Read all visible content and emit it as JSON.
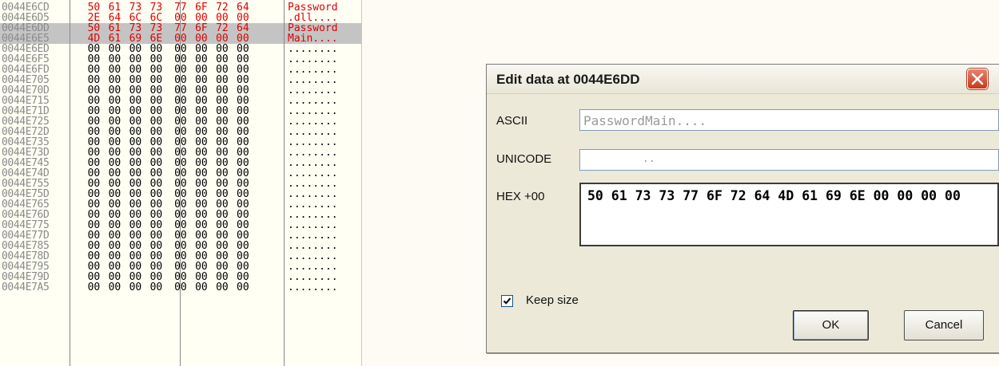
{
  "dump": {
    "rows": [
      {
        "addr": "0044E6CD",
        "bytes": [
          "50",
          "61",
          "73",
          "73",
          "77",
          "6F",
          "72",
          "64"
        ],
        "ascii": "Password",
        "style": "red"
      },
      {
        "addr": "0044E6D5",
        "bytes": [
          "2E",
          "64",
          "6C",
          "6C",
          "00",
          "00",
          "00",
          "00"
        ],
        "ascii": ".dll....",
        "style": "red"
      },
      {
        "addr": "0044E6DD",
        "bytes": [
          "50",
          "61",
          "73",
          "73",
          "77",
          "6F",
          "72",
          "64"
        ],
        "ascii": "Password",
        "style": "red-selected"
      },
      {
        "addr": "0044E6E5",
        "bytes": [
          "4D",
          "61",
          "69",
          "6E",
          "00",
          "00",
          "00",
          "00"
        ],
        "ascii": "Main....",
        "style": "red-selected"
      },
      {
        "addr": "0044E6ED",
        "bytes": [
          "00",
          "00",
          "00",
          "00",
          "00",
          "00",
          "00",
          "00"
        ],
        "ascii": "........",
        "style": "normal"
      },
      {
        "addr": "0044E6F5",
        "bytes": [
          "00",
          "00",
          "00",
          "00",
          "00",
          "00",
          "00",
          "00"
        ],
        "ascii": "........",
        "style": "normal"
      },
      {
        "addr": "0044E6FD",
        "bytes": [
          "00",
          "00",
          "00",
          "00",
          "00",
          "00",
          "00",
          "00"
        ],
        "ascii": "........",
        "style": "normal"
      },
      {
        "addr": "0044E705",
        "bytes": [
          "00",
          "00",
          "00",
          "00",
          "00",
          "00",
          "00",
          "00"
        ],
        "ascii": "........",
        "style": "normal"
      },
      {
        "addr": "0044E70D",
        "bytes": [
          "00",
          "00",
          "00",
          "00",
          "00",
          "00",
          "00",
          "00"
        ],
        "ascii": "........",
        "style": "normal"
      },
      {
        "addr": "0044E715",
        "bytes": [
          "00",
          "00",
          "00",
          "00",
          "00",
          "00",
          "00",
          "00"
        ],
        "ascii": "........",
        "style": "normal"
      },
      {
        "addr": "0044E71D",
        "bytes": [
          "00",
          "00",
          "00",
          "00",
          "00",
          "00",
          "00",
          "00"
        ],
        "ascii": "........",
        "style": "normal"
      },
      {
        "addr": "0044E725",
        "bytes": [
          "00",
          "00",
          "00",
          "00",
          "00",
          "00",
          "00",
          "00"
        ],
        "ascii": "........",
        "style": "normal"
      },
      {
        "addr": "0044E72D",
        "bytes": [
          "00",
          "00",
          "00",
          "00",
          "00",
          "00",
          "00",
          "00"
        ],
        "ascii": "........",
        "style": "normal"
      },
      {
        "addr": "0044E735",
        "bytes": [
          "00",
          "00",
          "00",
          "00",
          "00",
          "00",
          "00",
          "00"
        ],
        "ascii": "........",
        "style": "normal"
      },
      {
        "addr": "0044E73D",
        "bytes": [
          "00",
          "00",
          "00",
          "00",
          "00",
          "00",
          "00",
          "00"
        ],
        "ascii": "........",
        "style": "normal"
      },
      {
        "addr": "0044E745",
        "bytes": [
          "00",
          "00",
          "00",
          "00",
          "00",
          "00",
          "00",
          "00"
        ],
        "ascii": "........",
        "style": "normal"
      },
      {
        "addr": "0044E74D",
        "bytes": [
          "00",
          "00",
          "00",
          "00",
          "00",
          "00",
          "00",
          "00"
        ],
        "ascii": "........",
        "style": "normal"
      },
      {
        "addr": "0044E755",
        "bytes": [
          "00",
          "00",
          "00",
          "00",
          "00",
          "00",
          "00",
          "00"
        ],
        "ascii": "........",
        "style": "normal"
      },
      {
        "addr": "0044E75D",
        "bytes": [
          "00",
          "00",
          "00",
          "00",
          "00",
          "00",
          "00",
          "00"
        ],
        "ascii": "........",
        "style": "normal"
      },
      {
        "addr": "0044E765",
        "bytes": [
          "00",
          "00",
          "00",
          "00",
          "00",
          "00",
          "00",
          "00"
        ],
        "ascii": "........",
        "style": "normal"
      },
      {
        "addr": "0044E76D",
        "bytes": [
          "00",
          "00",
          "00",
          "00",
          "00",
          "00",
          "00",
          "00"
        ],
        "ascii": "........",
        "style": "normal"
      },
      {
        "addr": "0044E775",
        "bytes": [
          "00",
          "00",
          "00",
          "00",
          "00",
          "00",
          "00",
          "00"
        ],
        "ascii": "........",
        "style": "normal"
      },
      {
        "addr": "0044E77D",
        "bytes": [
          "00",
          "00",
          "00",
          "00",
          "00",
          "00",
          "00",
          "00"
        ],
        "ascii": "........",
        "style": "normal"
      },
      {
        "addr": "0044E785",
        "bytes": [
          "00",
          "00",
          "00",
          "00",
          "00",
          "00",
          "00",
          "00"
        ],
        "ascii": "........",
        "style": "normal"
      },
      {
        "addr": "0044E78D",
        "bytes": [
          "00",
          "00",
          "00",
          "00",
          "00",
          "00",
          "00",
          "00"
        ],
        "ascii": "........",
        "style": "normal"
      },
      {
        "addr": "0044E795",
        "bytes": [
          "00",
          "00",
          "00",
          "00",
          "00",
          "00",
          "00",
          "00"
        ],
        "ascii": "........",
        "style": "normal"
      },
      {
        "addr": "0044E79D",
        "bytes": [
          "00",
          "00",
          "00",
          "00",
          "00",
          "00",
          "00",
          "00"
        ],
        "ascii": "........",
        "style": "normal"
      },
      {
        "addr": "0044E7A5",
        "bytes": [
          "00",
          "00",
          "00",
          "00",
          "00",
          "00",
          "00",
          "00"
        ],
        "ascii": "........",
        "style": "normal"
      }
    ]
  },
  "dialog": {
    "title": "Edit data at 0044E6DD",
    "close_icon": "close-icon",
    "ascii_label": "ASCII",
    "ascii_value": "PasswordMain....",
    "unicode_label": "UNICODE",
    "unicode_value": "..",
    "hex_label": "HEX +00",
    "hex_value": "50 61 73 73 77 6F 72 64 4D 61 69 6E 00 00 00 00",
    "keep_size_label": "Keep size",
    "keep_size_checked": true,
    "ok_label": "OK",
    "cancel_label": "Cancel"
  },
  "colors": {
    "modified_bytes": "#e00000",
    "selection": "#c4c4c4",
    "close_button": "#c9381a",
    "dialog_bg": "#ece9d8"
  }
}
